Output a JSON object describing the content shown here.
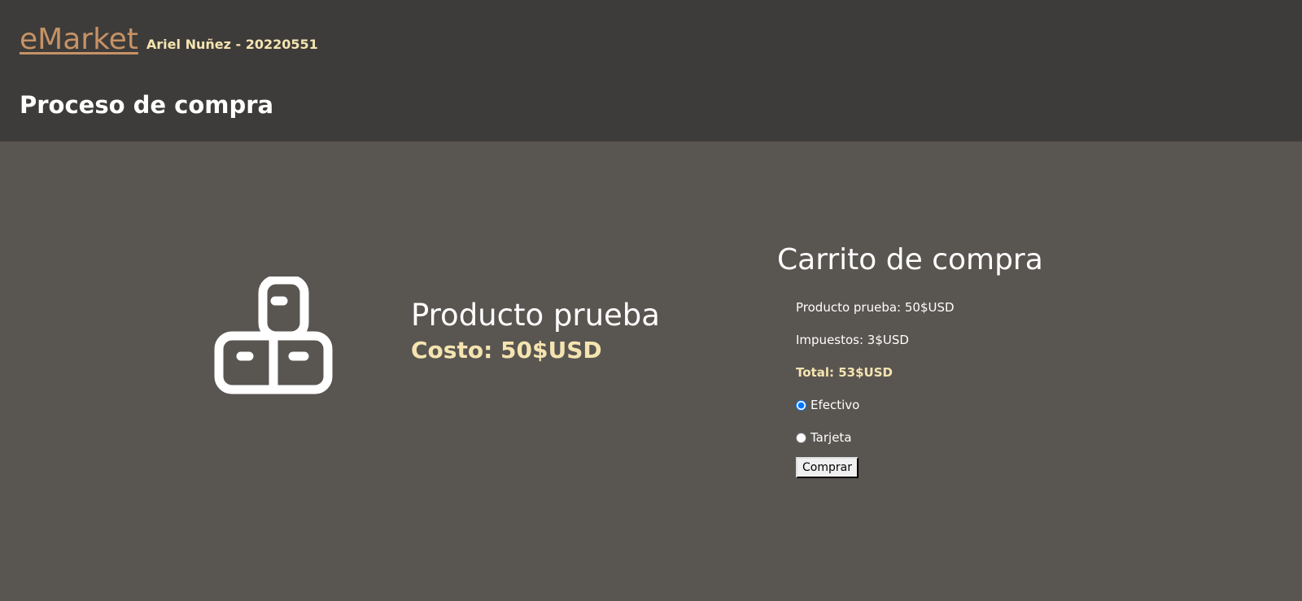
{
  "header": {
    "brand": "eMarket",
    "author": "Ariel Nuñez - 20220551",
    "page_title": "Proceso de compra"
  },
  "product": {
    "icon": "packages-icon",
    "name": "Producto prueba",
    "cost": "Costo: 50$USD"
  },
  "cart": {
    "title": "Carrito de compra",
    "item_line": "Producto prueba: 50$USD",
    "tax_line": "Impuestos: 3$USD",
    "total_line": "Total: 53$USD",
    "payment_options": [
      {
        "label": "Efectivo",
        "selected": true
      },
      {
        "label": "Tarjeta",
        "selected": false
      }
    ],
    "buy_label": "Comprar"
  },
  "colors": {
    "header_bg": "#3e3c3a",
    "page_bg": "#595551",
    "brand_link": "#c69265",
    "accent_text": "#f5e4b0"
  }
}
